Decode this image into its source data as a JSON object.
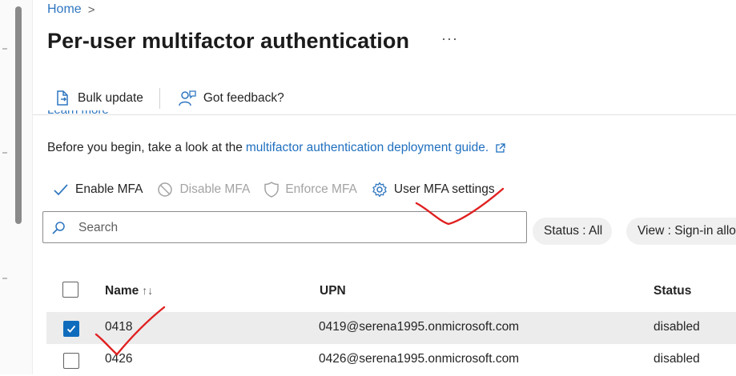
{
  "breadcrumb": {
    "home": "Home",
    "separator": ">"
  },
  "page": {
    "title": "Per-user multifactor authentication",
    "more": "···"
  },
  "commands": {
    "bulk_update": "Bulk update",
    "feedback": "Got feedback?"
  },
  "clipped_link": "Learn more",
  "intro": {
    "text": "Before you begin, take a look at the",
    "link": "multifactor authentication deployment guide."
  },
  "toolbar": {
    "enable": "Enable MFA",
    "disable": "Disable MFA",
    "enforce": "Enforce MFA",
    "settings": "User MFA settings"
  },
  "search": {
    "placeholder": "Search"
  },
  "filters": {
    "status": "Status : All",
    "view": "View : Sign-in allo"
  },
  "table": {
    "columns": {
      "name": "Name",
      "sort": "↑↓",
      "upn": "UPN",
      "status": "Status"
    },
    "rows": [
      {
        "name": "0418",
        "upn": "0419@serena1995.onmicrosoft.com",
        "status": "disabled",
        "selected": true
      },
      {
        "name": "0426",
        "upn": "0426@serena1995.onmicrosoft.com",
        "status": "disabled",
        "selected": false
      }
    ]
  },
  "colors": {
    "link": "#1f6fbf",
    "accent": "#0f6cbd",
    "disabled": "#a3a3a3",
    "annotation": "#e02020"
  },
  "icons": {
    "bulk_update": "document-arrow-icon",
    "feedback": "person-feedback-icon",
    "enable": "checkmark-icon",
    "disable": "prohibited-icon",
    "enforce": "shield-icon",
    "settings": "gear-icon",
    "search": "search-icon",
    "external": "open-external-icon"
  }
}
